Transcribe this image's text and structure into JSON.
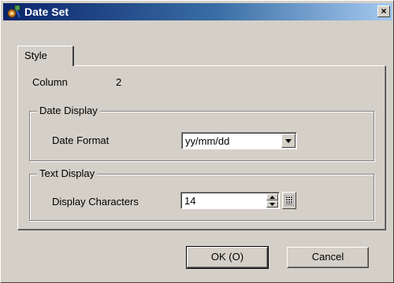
{
  "window": {
    "title": "Date Set",
    "title_icon": "gear-tools-icon",
    "close_glyph": "×"
  },
  "tabs": [
    {
      "label": "Style",
      "selected": true
    }
  ],
  "column": {
    "label": "Column",
    "value": "2"
  },
  "date_display": {
    "group_title": "Date Display",
    "format_label": "Date Format",
    "format_value": "yy/mm/dd"
  },
  "text_display": {
    "group_title": "Text Display",
    "chars_label": "Display Characters",
    "chars_value": "14"
  },
  "buttons": {
    "ok": "OK (O)",
    "cancel": "Cancel"
  },
  "colors": {
    "title_start": "#0a246a",
    "title_end": "#a6caf0",
    "face": "#d4d0c8"
  }
}
